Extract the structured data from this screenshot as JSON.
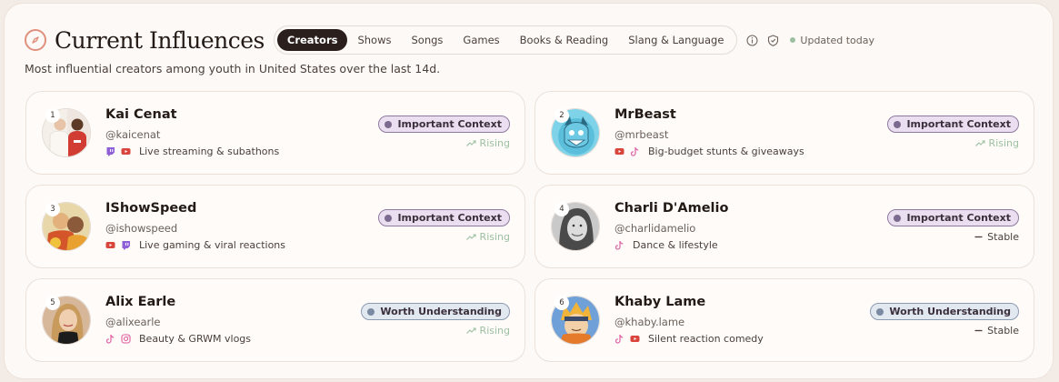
{
  "header": {
    "title": "Current Influences",
    "tabs": [
      {
        "label": "Creators",
        "active": true
      },
      {
        "label": "Shows"
      },
      {
        "label": "Songs"
      },
      {
        "label": "Games"
      },
      {
        "label": "Books & Reading"
      },
      {
        "label": "Slang & Language"
      }
    ],
    "updated": "Updated today"
  },
  "subtitle": "Most influential creators among youth in United States over the last 14d.",
  "cards": [
    {
      "rank": "1",
      "name": "Kai Cenat",
      "handle": "@kaicenat",
      "platforms": [
        "twitch-icon",
        "youtube-icon"
      ],
      "desc": "Live streaming & subathons",
      "badge": "Important Context",
      "trend": "Rising"
    },
    {
      "rank": "2",
      "name": "MrBeast",
      "handle": "@mrbeast",
      "platforms": [
        "youtube-icon",
        "tiktok-icon"
      ],
      "desc": "Big-budget stunts & giveaways",
      "badge": "Important Context",
      "trend": "Rising"
    },
    {
      "rank": "3",
      "name": "IShowSpeed",
      "handle": "@ishowspeed",
      "platforms": [
        "youtube-icon",
        "twitch-icon"
      ],
      "desc": "Live gaming & viral reactions",
      "badge": "Important Context",
      "trend": "Rising"
    },
    {
      "rank": "4",
      "name": "Charli D'Amelio",
      "handle": "@charlidamelio",
      "platforms": [
        "tiktok-icon"
      ],
      "desc": "Dance & lifestyle",
      "badge": "Important Context",
      "trend": "Stable"
    },
    {
      "rank": "5",
      "name": "Alix Earle",
      "handle": "@alixearle",
      "platforms": [
        "tiktok-icon",
        "instagram-icon"
      ],
      "desc": "Beauty & GRWM vlogs",
      "badge": "Worth Understanding",
      "trend": "Rising"
    },
    {
      "rank": "6",
      "name": "Khaby Lame",
      "handle": "@khaby.lame",
      "platforms": [
        "tiktok-icon",
        "youtube-icon"
      ],
      "desc": "Silent reaction comedy",
      "badge": "Worth Understanding",
      "trend": "Stable"
    }
  ],
  "colors": {
    "accent": "#2a1f1c",
    "rising": "#9bbfa0",
    "important_badge": "#eadff0",
    "worth_badge": "#e2e8f0",
    "twitch": "#8e5fd6",
    "youtube": "#d9453c",
    "tiktok": "#e06aa8",
    "instagram": "#e05a9a"
  }
}
